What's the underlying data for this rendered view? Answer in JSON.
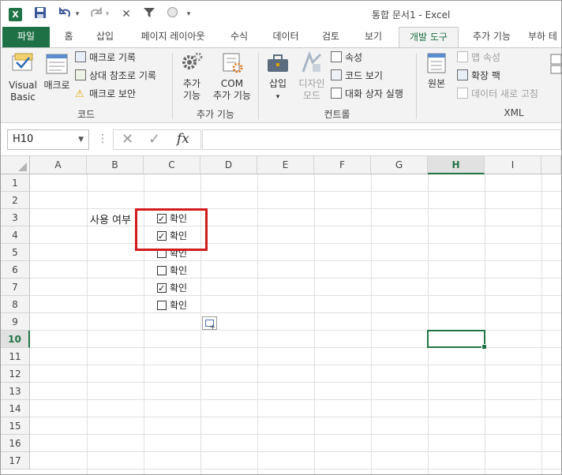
{
  "window": {
    "title": "통합 문서1 - Excel",
    "app_logo": "X"
  },
  "qat": {
    "icons": [
      "excel-logo-icon",
      "save-icon",
      "undo-icon",
      "redo-icon",
      "close-x-icon",
      "filter-icon",
      "circle-icon",
      "customize-dropdown-icon"
    ]
  },
  "tabs": [
    {
      "label": "파일"
    },
    {
      "label": "홈"
    },
    {
      "label": "삽입"
    },
    {
      "label": "페이지 레이아웃"
    },
    {
      "label": "수식"
    },
    {
      "label": "데이터"
    },
    {
      "label": "검토"
    },
    {
      "label": "보기"
    },
    {
      "label": "개발 도구"
    },
    {
      "label": "추가 기능"
    },
    {
      "label": "부하 테"
    }
  ],
  "active_tab": "개발 도구",
  "ribbon": {
    "code": {
      "group_label": "코드",
      "visual_basic_1": "Visual",
      "visual_basic_2": "Basic",
      "macro": "매크로",
      "record_macro": "매크로 기록",
      "relative_ref": "상대 참조로 기록",
      "macro_security": "매크로 보안"
    },
    "addins": {
      "group_label": "추가 기능",
      "addins_1": "추가",
      "addins_2": "기능",
      "com_1": "COM",
      "com_2": "추가 기능"
    },
    "controls": {
      "group_label": "컨트롤",
      "insert": "삽입",
      "design_1": "디자인",
      "design_2": "모드",
      "properties": "속성",
      "view_code": "코드 보기",
      "run_dialog": "대화 상자 실행"
    },
    "xml": {
      "group_label": "XML",
      "source": "원본",
      "map_props": "맵 속성",
      "expansion_pack": "확장 팩",
      "refresh_data": "데이터 새로 고침"
    }
  },
  "formula_bar": {
    "name_box": "H10",
    "fx": "fx",
    "value": ""
  },
  "sheet": {
    "columns": [
      "A",
      "B",
      "C",
      "D",
      "E",
      "F",
      "G",
      "H",
      "I"
    ],
    "rows": [
      "1",
      "2",
      "3",
      "4",
      "5",
      "6",
      "7",
      "8",
      "9",
      "10",
      "11",
      "12",
      "13",
      "14",
      "15",
      "16",
      "17"
    ],
    "selected_cell": "H10",
    "label_B3": "사용 여부",
    "checkboxes": [
      {
        "row": "3",
        "label": "확인",
        "checked": true
      },
      {
        "row": "4",
        "label": "확인",
        "checked": true
      },
      {
        "row": "5",
        "label": "확인",
        "checked": false
      },
      {
        "row": "6",
        "label": "확인",
        "checked": false
      },
      {
        "row": "7",
        "label": "확인",
        "checked": true
      },
      {
        "row": "8",
        "label": "확인",
        "checked": false
      }
    ]
  },
  "colors": {
    "excel_green": "#217346",
    "file_tab": "#1e7145",
    "highlight_red": "#d21b1b"
  }
}
